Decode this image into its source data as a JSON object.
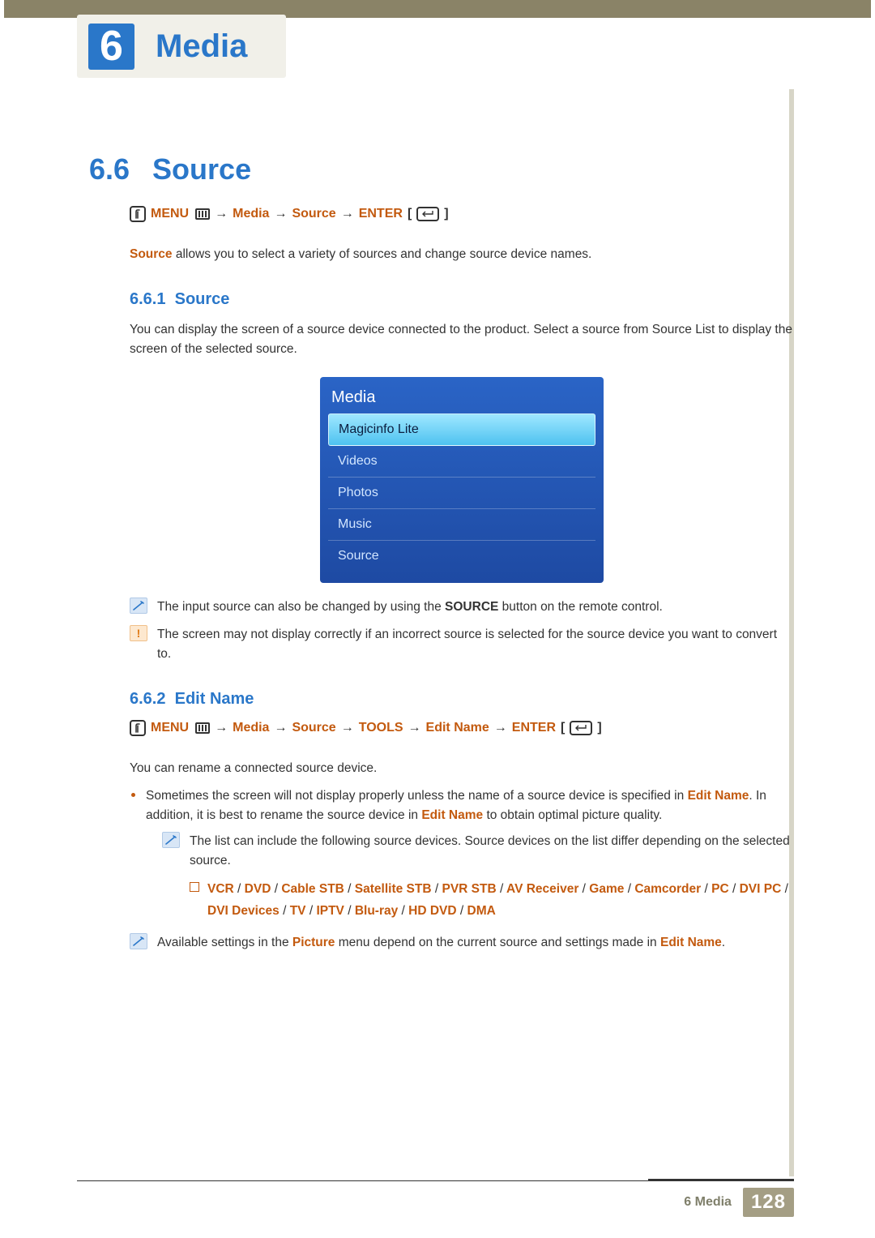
{
  "chapter": {
    "number": "6",
    "title": "Media"
  },
  "section": {
    "number": "6.6",
    "title": "Source"
  },
  "nav1": {
    "menu": "MENU",
    "media": "Media",
    "source": "Source",
    "enter": "ENTER"
  },
  "intro": {
    "source_bold": "Source",
    "rest": " allows you to select a variety of sources and change source device names."
  },
  "sub1": {
    "number": "6.6.1",
    "title": "Source"
  },
  "para1": "You can display the screen of a source device connected to the product. Select a source from Source List to display the screen of the selected source.",
  "panel": {
    "title": "Media",
    "items": [
      {
        "label": "Magicinfo Lite",
        "selected": true
      },
      {
        "label": "Videos",
        "selected": false
      },
      {
        "label": "Photos",
        "selected": false
      },
      {
        "label": "Music",
        "selected": false
      },
      {
        "label": "Source",
        "selected": false
      }
    ]
  },
  "note1": {
    "pre": "The input source can also be changed by using the ",
    "bold": "SOURCE",
    "post": " button on the remote control."
  },
  "warn1": "The screen may not display correctly if an incorrect source is selected for the source device you want to convert to.",
  "sub2": {
    "number": "6.6.2",
    "title": "Edit Name"
  },
  "nav2": {
    "menu": "MENU",
    "media": "Media",
    "source": "Source",
    "tools": "TOOLS",
    "edit": "Edit Name",
    "enter": "ENTER"
  },
  "para2": "You can rename a connected source device.",
  "bullet1_pre": "Sometimes the screen will not display properly unless the name of a source device is specified in ",
  "bullet1_hi1": "Edit Name",
  "bullet1_mid": ". In addition, it is best to rename the source device in ",
  "bullet1_hi2": "Edit Name",
  "bullet1_post": " to obtain optimal picture quality.",
  "note2": "The list can include the following source devices. Source devices on the list differ depending on the selected source.",
  "devices": [
    "VCR",
    "DVD",
    "Cable STB",
    "Satellite STB",
    "PVR STB",
    "AV Receiver",
    "Game",
    "Camcorder",
    "PC",
    "DVI PC",
    "DVI Devices",
    "TV",
    "IPTV",
    "Blu-ray",
    "HD DVD",
    "DMA"
  ],
  "note3_pre": "Available settings in the ",
  "note3_hi1": "Picture",
  "note3_mid": " menu depend on the current source and settings made in ",
  "note3_hi2": "Edit Name",
  "note3_post": ".",
  "footer": {
    "label": "6 Media",
    "page": "128"
  }
}
